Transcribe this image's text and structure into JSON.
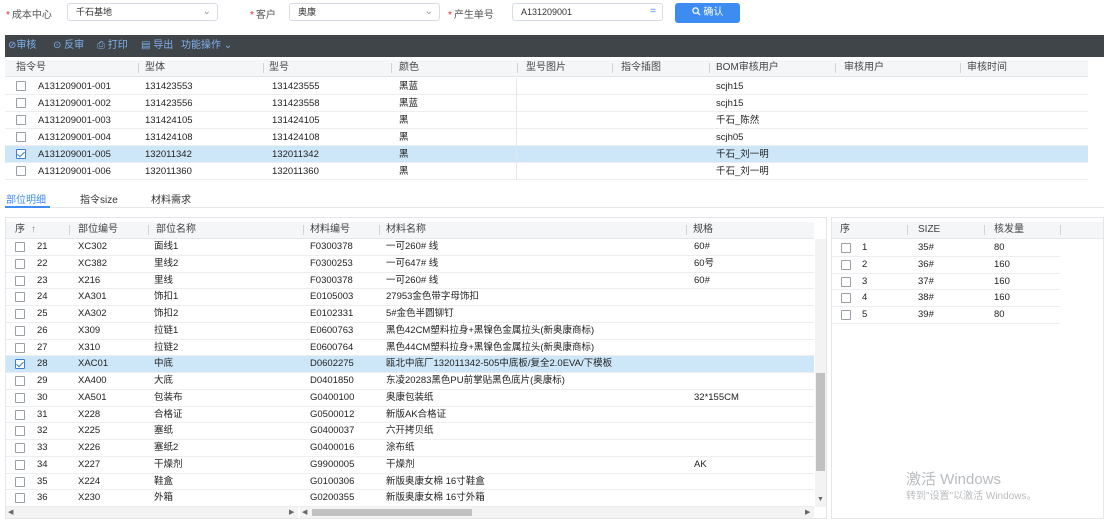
{
  "filters": {
    "cost_center": {
      "label": "成本中心",
      "value": "千石基地"
    },
    "customer": {
      "label": "客户",
      "value": "奥康"
    },
    "order_no": {
      "label": "产生单号",
      "value": "A131209001",
      "suffix": "="
    },
    "confirm_label": "确认"
  },
  "toolbar": {
    "audit": "审核",
    "unaudit": "反审",
    "print": "打印",
    "export": "导出",
    "functions": "功能操作"
  },
  "top_grid": {
    "columns": [
      "指令号",
      "型体",
      "型号",
      "颜色",
      "型号图片",
      "指令插图",
      "BOM审核用户",
      "审核用户",
      "审核时间"
    ],
    "rows": [
      {
        "order": "A131209001-001",
        "style": "131423553",
        "model": "131423555",
        "color": "黑蓝",
        "bom_user": "scjh15",
        "checked": false
      },
      {
        "order": "A131209001-002",
        "style": "131423556",
        "model": "131423558",
        "color": "黑蓝",
        "bom_user": "scjh15",
        "checked": false
      },
      {
        "order": "A131209001-003",
        "style": "131424105",
        "model": "131424105",
        "color": "黑",
        "bom_user": "千石_陈然",
        "checked": false
      },
      {
        "order": "A131209001-004",
        "style": "131424108",
        "model": "131424108",
        "color": "黑",
        "bom_user": "scjh05",
        "checked": false
      },
      {
        "order": "A131209001-005",
        "style": "132011342",
        "model": "132011342",
        "color": "黑",
        "bom_user": "千石_刘一明",
        "checked": true
      },
      {
        "order": "A131209001-006",
        "style": "132011360",
        "model": "132011360",
        "color": "黑",
        "bom_user": "千石_刘一明",
        "checked": false
      }
    ]
  },
  "tabs": [
    "部位明细",
    "指令size",
    "材料需求"
  ],
  "parts_grid": {
    "columns": [
      "序",
      "部位编号",
      "部位名称",
      "材料编号",
      "材料名称",
      "规格"
    ],
    "sort_icon": "sort-up-icon",
    "rows": [
      {
        "seq": "21",
        "code": "XC302",
        "name": "面线1",
        "mat_code": "F0300378",
        "mat_name": "一可260# 线",
        "spec": "60#",
        "checked": false
      },
      {
        "seq": "22",
        "code": "XC382",
        "name": "里线2",
        "mat_code": "F0300253",
        "mat_name": "一可647# 线",
        "spec": "60号",
        "checked": false
      },
      {
        "seq": "23",
        "code": "X216",
        "name": "里线",
        "mat_code": "F0300378",
        "mat_name": "一可260# 线",
        "spec": "60#",
        "checked": false
      },
      {
        "seq": "24",
        "code": "XA301",
        "name": "饰扣1",
        "mat_code": "E0105003",
        "mat_name": "27953金色带字母饰扣",
        "spec": "",
        "checked": false
      },
      {
        "seq": "25",
        "code": "XA302",
        "name": "饰扣2",
        "mat_code": "E0102331",
        "mat_name": "5#金色半圆铆钉",
        "spec": "",
        "checked": false
      },
      {
        "seq": "26",
        "code": "X309",
        "name": "拉链1",
        "mat_code": "E0600763",
        "mat_name": "黑色42CM塑料拉身+黑镍色金属拉头(新奥康商标)",
        "spec": "",
        "checked": false
      },
      {
        "seq": "27",
        "code": "X310",
        "name": "拉链2",
        "mat_code": "E0600764",
        "mat_name": "黑色44CM塑料拉身+黑镍色金属拉头(新奥康商标)",
        "spec": "",
        "checked": false
      },
      {
        "seq": "28",
        "code": "XAC01",
        "name": "中底",
        "mat_code": "D0602275",
        "mat_name": "瓯北中底厂132011342-505中底板/复全2.0EVA/下模板",
        "spec": "",
        "checked": true
      },
      {
        "seq": "29",
        "code": "XA400",
        "name": "大底",
        "mat_code": "D0401850",
        "mat_name": "东凌20283黑色PU前掌贴黑色底片(奥康标)",
        "spec": "",
        "checked": false
      },
      {
        "seq": "30",
        "code": "XA501",
        "name": "包装布",
        "mat_code": "G0400100",
        "mat_name": "奥康包装纸",
        "spec": "32*155CM",
        "checked": false
      },
      {
        "seq": "31",
        "code": "X228",
        "name": "合格证",
        "mat_code": "G0500012",
        "mat_name": "新版AK合格证",
        "spec": "",
        "checked": false
      },
      {
        "seq": "32",
        "code": "X225",
        "name": "塞纸",
        "mat_code": "G0400037",
        "mat_name": "六开拷贝纸",
        "spec": "",
        "checked": false
      },
      {
        "seq": "33",
        "code": "X226",
        "name": "塞纸2",
        "mat_code": "G0400016",
        "mat_name": "涂布纸",
        "spec": "",
        "checked": false
      },
      {
        "seq": "34",
        "code": "X227",
        "name": "干燥剂",
        "mat_code": "G9900005",
        "mat_name": "干燥剂",
        "spec": "AK",
        "checked": false
      },
      {
        "seq": "35",
        "code": "X224",
        "name": "鞋盒",
        "mat_code": "G0100306",
        "mat_name": "新版奥康女棉 16寸鞋盒",
        "spec": "",
        "checked": false
      },
      {
        "seq": "36",
        "code": "X230",
        "name": "外箱",
        "mat_code": "G0200355",
        "mat_name": "新版奥康女棉 16寸外箱",
        "spec": "",
        "checked": false
      }
    ]
  },
  "size_grid": {
    "columns": [
      "序",
      "SIZE",
      "核发量"
    ],
    "rows": [
      {
        "seq": "1",
        "size": "35#",
        "qty": "80"
      },
      {
        "seq": "2",
        "size": "36#",
        "qty": "160"
      },
      {
        "seq": "3",
        "size": "37#",
        "qty": "160"
      },
      {
        "seq": "4",
        "size": "38#",
        "qty": "160"
      },
      {
        "seq": "5",
        "size": "39#",
        "qty": "80"
      }
    ]
  },
  "watermark": {
    "line1": "激活 Windows",
    "line2": "转到\"设置\"以激活 Windows。"
  },
  "colors": {
    "accent": "#3d8cf2",
    "toolbar_bg": "#404549",
    "selected_row": "#cde7f8"
  }
}
